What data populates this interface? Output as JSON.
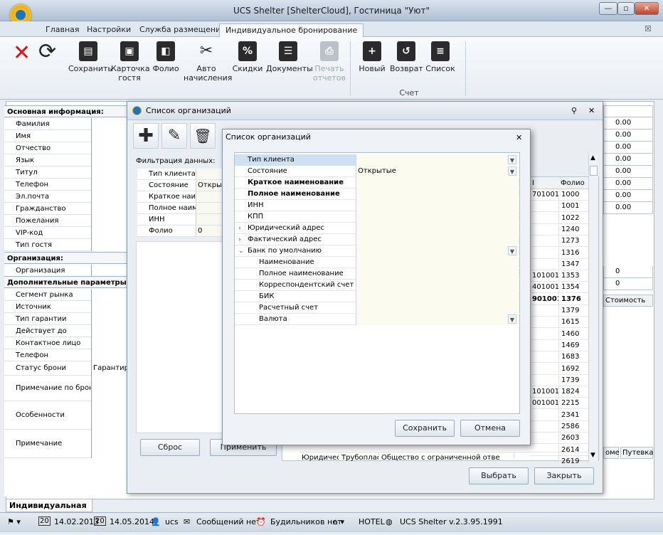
{
  "app": {
    "title": "UCS Shelter [ShelterCloud], Гостиница \"Уют\"",
    "window_buttons": {
      "minimize": "—",
      "maximize": "▫",
      "close": "✕"
    }
  },
  "ribbon_tabs": [
    "Главная",
    "Настройки",
    "Служба размещения",
    "Индивидуальное бронирование"
  ],
  "ribbon": {
    "buttons": [
      {
        "label": "Сохранить",
        "icon": "save-icon"
      },
      {
        "label": "Карточка\nгостя",
        "icon": "guest-card-icon"
      },
      {
        "label": "Фолио",
        "icon": "wallet-icon"
      },
      {
        "label": "Авто\nначисления",
        "icon": "tools-icon"
      },
      {
        "label": "Скидки",
        "icon": "percent-icon"
      },
      {
        "label": "Документы",
        "icon": "document-icon"
      },
      {
        "label": "Печать\nотчетов",
        "icon": "printer-icon",
        "disabled": true
      },
      {
        "label": "Новый",
        "icon": "new-invoice-icon"
      },
      {
        "label": "Возврат",
        "icon": "return-invoice-icon"
      },
      {
        "label": "Список",
        "icon": "list-icon"
      }
    ],
    "group_label": "Счет",
    "close_glyph": "✕",
    "refresh_glyph": "⟳",
    "pin_glyph": "☒"
  },
  "left_panel": {
    "sections": [
      {
        "header": "Основная информация:",
        "rows": [
          "Фамилия",
          "Имя",
          "Отчество",
          "Язык",
          "Титул",
          "Телефон",
          "Эл.почта",
          "Гражданство",
          "Пожелания",
          "VIP-код",
          "Тип гостя"
        ]
      },
      {
        "header": "Организация:",
        "rows": [
          "Организация"
        ]
      },
      {
        "header": "Дополнительные параметры",
        "rows": [
          "Сегмент рынка",
          "Источник",
          "Тип гарантии",
          "Действует до",
          "Контактное лицо",
          "Телефон"
        ]
      }
    ],
    "status_label": "Статус брони",
    "status_value": "Гарантиро",
    "note_label": "Примечание по брони",
    "features_label": "Особенности",
    "remark_label": "Примечание"
  },
  "right_values": {
    "amounts": [
      "0.00",
      "0.00",
      "0.00",
      "0.00",
      "0.00",
      "0.00",
      "0.00",
      "0.00"
    ],
    "zero_a": "0",
    "zero_b": "0",
    "cost_header": "Стоимость",
    "col_a": "оме",
    "col_b": "Путевка"
  },
  "bottom_tab": "Индивидуальная броня",
  "statusbar": {
    "date_from": "14.02.2013",
    "date_to": "14.05.2014",
    "user": "ucs",
    "messages": "Сообщений нет",
    "alarms": "Будильников нет",
    "hotel": "HOTEL",
    "version": "UCS Shelter v.2.3.95.1991"
  },
  "org_dialog": {
    "title": "Список организаций",
    "title_buttons": {
      "pin": "⚲",
      "close": "✕"
    },
    "toolbar_glyphs": {
      "add": "✚",
      "edit": "✎",
      "delete": "🗑"
    },
    "filter_title": "Фильтрация данных:",
    "filters": [
      {
        "label": "Тип клиента",
        "value": ""
      },
      {
        "label": "Состояние",
        "value": "Открыты"
      },
      {
        "label": "Краткое наиме",
        "value": ""
      },
      {
        "label": "Полное наимен",
        "value": ""
      },
      {
        "label": "ИНН",
        "value": ""
      },
      {
        "label": "Фолио",
        "value": "0"
      }
    ],
    "reset_button": "Сброс",
    "apply_button": "Применить",
    "select_button": "Выбрать",
    "close_button": "Закрыть",
    "grid": {
      "col_right": "Фолио",
      "col_left": "І",
      "rows": [
        {
          "a": "701001",
          "b": "1000"
        },
        {
          "a": "",
          "b": "1001"
        },
        {
          "a": "",
          "b": "1022"
        },
        {
          "a": "",
          "b": "1240"
        },
        {
          "a": "",
          "b": "1273"
        },
        {
          "a": "",
          "b": "1316"
        },
        {
          "a": "",
          "b": "1347"
        },
        {
          "a": "101001",
          "b": "1353"
        },
        {
          "a": "401001",
          "b": "1354"
        },
        {
          "a": "901001",
          "b": "1376"
        },
        {
          "a": "",
          "b": "1379"
        },
        {
          "a": "",
          "b": "1615"
        },
        {
          "a": "",
          "b": "1460"
        },
        {
          "a": "",
          "b": "1469"
        },
        {
          "a": "",
          "b": "1683"
        },
        {
          "a": "",
          "b": "1692"
        },
        {
          "a": "",
          "b": "1739"
        },
        {
          "a": "101001",
          "b": "1824"
        },
        {
          "a": "001001",
          "b": "2215"
        },
        {
          "a": "",
          "b": "2341"
        },
        {
          "a": "",
          "b": "2586"
        },
        {
          "a": "",
          "b": "2603"
        },
        {
          "a": "",
          "b": "2614"
        },
        {
          "a": "",
          "b": "2619"
        }
      ],
      "last_row": {
        "c1": "Юридическ",
        "c2": "Трубопласт",
        "c3": "Общество с ограниченной отве"
      }
    }
  },
  "inner_dialog": {
    "title": "Список организаций",
    "close_glyph": "✕",
    "properties": [
      {
        "label": "Тип клиента",
        "value": "",
        "level": 1,
        "dropdown": true,
        "selected": true
      },
      {
        "label": "Состояние",
        "value": "Открытые",
        "level": 1,
        "dropdown": true
      },
      {
        "label": "Краткое наименование",
        "value": "",
        "level": 1,
        "bold": true
      },
      {
        "label": "Полное наименование",
        "value": "",
        "level": 1,
        "bold": true
      },
      {
        "label": "ИНН",
        "value": "",
        "level": 1
      },
      {
        "label": "КПП",
        "value": "",
        "level": 1
      },
      {
        "label": "Юридический адрес",
        "value": "",
        "level": 1,
        "expander": "›"
      },
      {
        "label": "Фактический адрес",
        "value": "",
        "level": 1,
        "expander": "›"
      },
      {
        "label": "Банк по умолчанию",
        "value": "",
        "level": 1,
        "expander": "⌄",
        "dropdown": true
      },
      {
        "label": "Наименование",
        "value": "",
        "level": 2
      },
      {
        "label": "Полное наименование",
        "value": "",
        "level": 2
      },
      {
        "label": "Корреспондентский счет",
        "value": "",
        "level": 2
      },
      {
        "label": "БИК",
        "value": "",
        "level": 2
      },
      {
        "label": "Расчетный счет",
        "value": "",
        "level": 2
      },
      {
        "label": "Валюта",
        "value": "",
        "level": 2,
        "dropdown": true
      }
    ],
    "save_button": "Сохранить",
    "cancel_button": "Отмена"
  }
}
